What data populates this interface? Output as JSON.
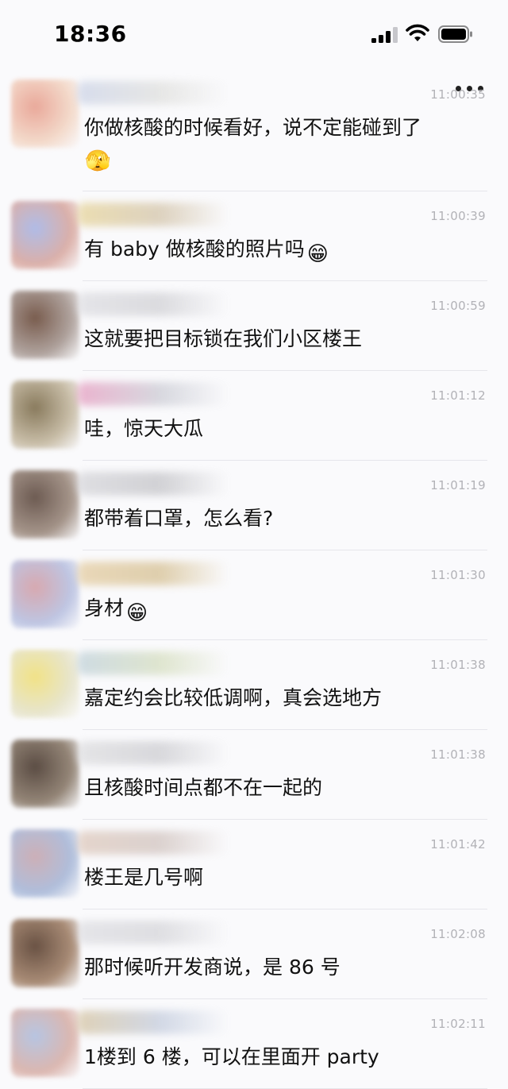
{
  "status_bar": {
    "time": "18:36"
  },
  "messages": [
    {
      "time": "11:00:35",
      "text": "你做核酸的时候看好，说不定能碰到了",
      "emoji2": "🫣",
      "avatar_colors": [
        "#e8a090",
        "#f3d7c6"
      ],
      "name_colors": [
        "#cfd6e8",
        "#e2e2e0"
      ]
    },
    {
      "time": "11:00:39",
      "text": "有 baby 做核酸的照片吗",
      "emoji": "😁",
      "avatar_colors": [
        "#a8b6e6",
        "#d8a8a0"
      ],
      "name_colors": [
        "#e8d7a0",
        "#d6c8b0"
      ]
    },
    {
      "time": "11:00:59",
      "text": "这就要把目标锁在我们小区楼王",
      "avatar_colors": [
        "#6b4b3b",
        "#a89a94"
      ],
      "name_colors": [
        "#e0e0e4",
        "#d4d4d8"
      ]
    },
    {
      "time": "11:01:12",
      "text": "哇，惊天大瓜",
      "avatar_colors": [
        "#7d6d4c",
        "#c4b8a0"
      ],
      "name_colors": [
        "#e7a3c4",
        "#cfd0d8"
      ]
    },
    {
      "time": "11:01:19",
      "text": "都带着口罩，怎么看?",
      "avatar_colors": [
        "#5e4a40",
        "#9c8a7e"
      ],
      "name_colors": [
        "#d8d8dc",
        "#c8c8cc"
      ]
    },
    {
      "time": "11:01:30",
      "text": "身材",
      "emoji": "😁",
      "avatar_colors": [
        "#d4a0a8",
        "#b8c0e0"
      ],
      "name_colors": [
        "#e6d0a8",
        "#d8c49a"
      ]
    },
    {
      "time": "11:01:38",
      "text": "嘉定约会比较低调啊，真会选地方",
      "avatar_colors": [
        "#f0e07a",
        "#e6e3c8"
      ],
      "name_colors": [
        "#c4d4dc",
        "#d8e0c4"
      ]
    },
    {
      "time": "11:01:38",
      "text": "且核酸时间点都不在一起的",
      "avatar_colors": [
        "#4a3a30",
        "#8a7a6a"
      ],
      "name_colors": [
        "#e0e0e2",
        "#d0d0d4"
      ]
    },
    {
      "time": "11:01:42",
      "text": "楼王是几号啊",
      "avatar_colors": [
        "#c8a8b0",
        "#a8b8d8"
      ],
      "name_colors": [
        "#e0ccc0",
        "#d4c8c4"
      ]
    },
    {
      "time": "11:02:08",
      "text": "那时候听开发商说，是 86 号",
      "avatar_colors": [
        "#5a4030",
        "#a08068"
      ],
      "name_colors": [
        "#e0e0e4",
        "#d8d8dc"
      ]
    },
    {
      "time": "11:02:11",
      "text": "1楼到 6 楼，可以在里面开 party",
      "avatar_colors": [
        "#b0c0e0",
        "#d8b0a8"
      ],
      "name_colors": [
        "#d8c8a8",
        "#c8d0e0"
      ]
    }
  ]
}
